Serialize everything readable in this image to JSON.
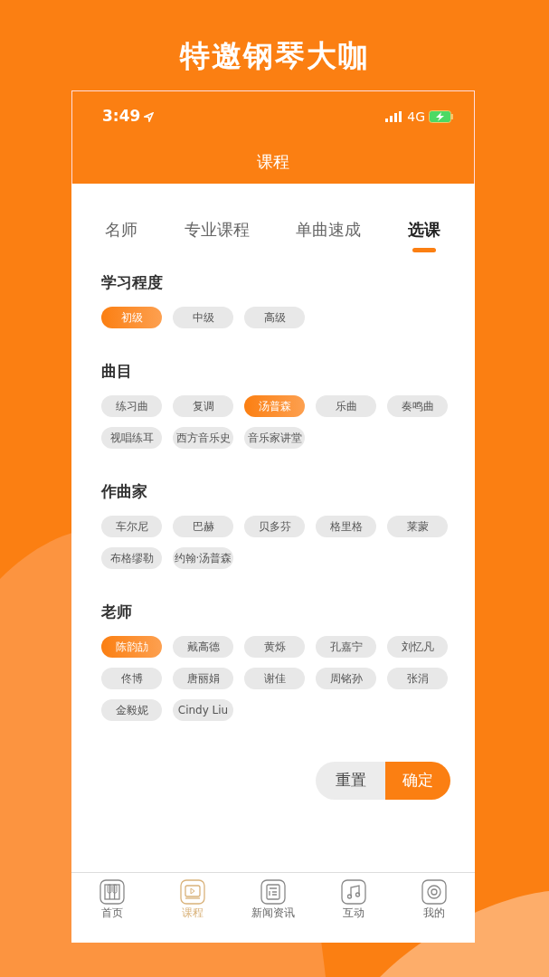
{
  "headline": "特邀钢琴大咖",
  "status_bar": {
    "time": "3:49",
    "network": "4G"
  },
  "header_title": "课程",
  "tabs": [
    {
      "label": "名师",
      "selected": false
    },
    {
      "label": "专业课程",
      "selected": false
    },
    {
      "label": "单曲速成",
      "selected": false
    },
    {
      "label": "选课",
      "selected": true
    }
  ],
  "sections": [
    {
      "title": "学习程度",
      "options": [
        {
          "label": "初级",
          "selected": true
        },
        {
          "label": "中级",
          "selected": false
        },
        {
          "label": "高级",
          "selected": false
        }
      ]
    },
    {
      "title": "曲目",
      "options": [
        {
          "label": "练习曲",
          "selected": false
        },
        {
          "label": "复调",
          "selected": false
        },
        {
          "label": "汤普森",
          "selected": true
        },
        {
          "label": "乐曲",
          "selected": false
        },
        {
          "label": "奏鸣曲",
          "selected": false
        },
        {
          "label": "视唱练耳",
          "selected": false
        },
        {
          "label": "西方音乐史",
          "selected": false
        },
        {
          "label": "音乐家讲堂",
          "selected": false
        }
      ]
    },
    {
      "title": "作曲家",
      "options": [
        {
          "label": "车尔尼",
          "selected": false
        },
        {
          "label": "巴赫",
          "selected": false
        },
        {
          "label": "贝多芬",
          "selected": false
        },
        {
          "label": "格里格",
          "selected": false
        },
        {
          "label": "莱蒙",
          "selected": false
        },
        {
          "label": "布格缪勒",
          "selected": false
        },
        {
          "label": "约翰·汤普森",
          "selected": false
        }
      ]
    },
    {
      "title": "老师",
      "options": [
        {
          "label": "陈韵劼",
          "selected": true
        },
        {
          "label": "戴高德",
          "selected": false
        },
        {
          "label": "黄烁",
          "selected": false
        },
        {
          "label": "孔嘉宁",
          "selected": false
        },
        {
          "label": "刘忆凡",
          "selected": false
        },
        {
          "label": "佟博",
          "selected": false
        },
        {
          "label": "唐丽娟",
          "selected": false
        },
        {
          "label": "谢佳",
          "selected": false
        },
        {
          "label": "周铭孙",
          "selected": false
        },
        {
          "label": "张涓",
          "selected": false
        },
        {
          "label": "金毅妮",
          "selected": false
        },
        {
          "label": "Cindy Liu",
          "selected": false
        }
      ]
    }
  ],
  "buttons": {
    "reset": "重置",
    "confirm": "确定"
  },
  "tab_bar": [
    {
      "kind": "piano",
      "label": "首页",
      "selected": false
    },
    {
      "kind": "video",
      "label": "课程",
      "selected": true
    },
    {
      "kind": "news",
      "label": "新闻资讯",
      "selected": false
    },
    {
      "kind": "music",
      "label": "互动",
      "selected": false
    },
    {
      "kind": "profile",
      "label": "我的",
      "selected": false
    }
  ]
}
